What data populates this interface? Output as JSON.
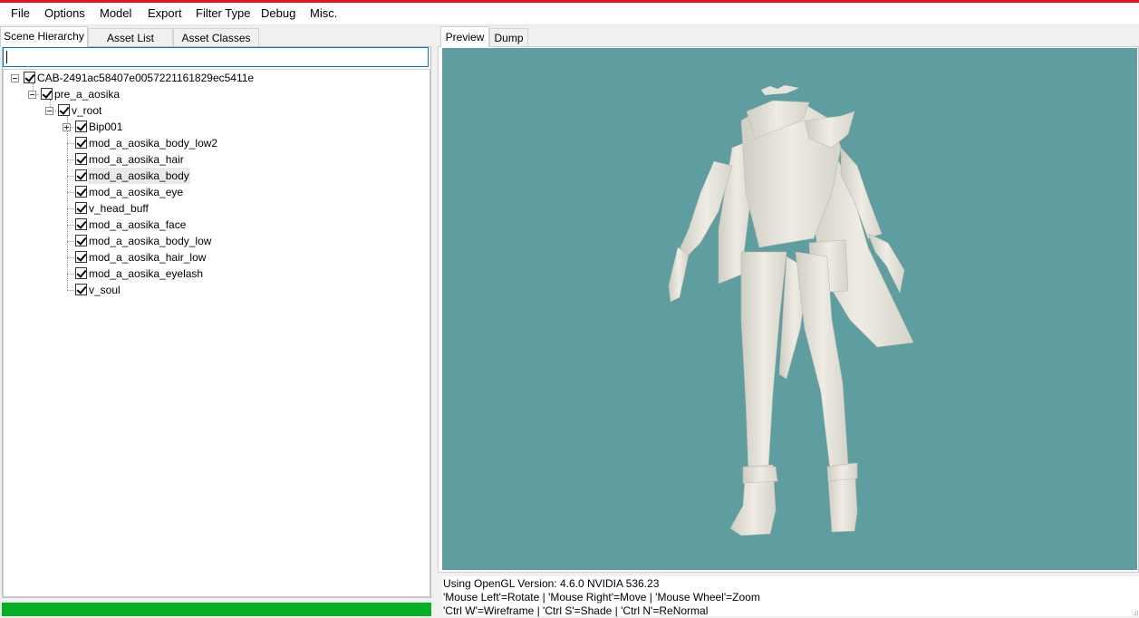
{
  "menu": {
    "items": [
      "File",
      "Options",
      "Model",
      "Export",
      "Filter Type",
      "Debug",
      "Misc."
    ]
  },
  "left_tabs": {
    "scene_hierarchy": "Scene Hierarchy",
    "asset_list": "Asset List",
    "asset_classes": "Asset Classes"
  },
  "search": {
    "value": "",
    "placeholder": ""
  },
  "tree": {
    "root": "CAB-2491ac58407e0057221161829ec5411e",
    "child": "pre_a_aosika",
    "v_root": "v_root",
    "bip": "Bip001",
    "leaves": [
      "mod_a_aosika_body_low2",
      "mod_a_aosika_hair",
      "mod_a_aosika_body",
      "mod_a_aosika_eye",
      "v_head_buff",
      "mod_a_aosika_face",
      "mod_a_aosika_body_low",
      "mod_a_aosika_hair_low",
      "mod_a_aosika_eyelash",
      "v_soul"
    ],
    "selected": "mod_a_aosika_body"
  },
  "right_tabs": {
    "preview": "Preview",
    "dump": "Dump"
  },
  "status": {
    "line1": "Using OpenGL Version: 4.6.0 NVIDIA 536.23",
    "line2": "'Mouse Left'=Rotate | 'Mouse Right'=Move | 'Mouse Wheel'=Zoom",
    "line3": "'Ctrl W'=Wireframe | 'Ctrl S'=Shade | 'Ctrl N'=ReNormal"
  },
  "progress": {
    "value": 1.0,
    "color": "#06b025"
  },
  "colors": {
    "viewport_bg": "#5f9ea0",
    "model": "#e8e6dc",
    "title_accent": "#e81123"
  }
}
